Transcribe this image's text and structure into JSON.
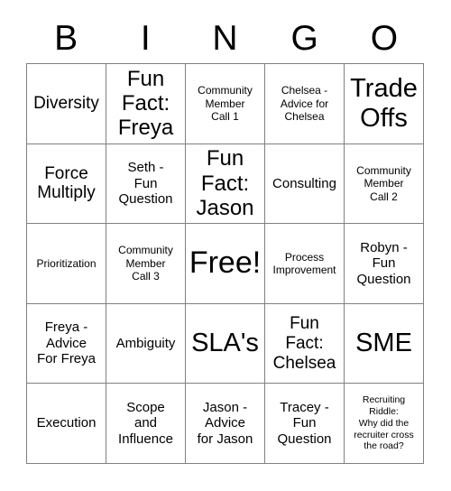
{
  "card": {
    "title": "BINGO",
    "header_letters": [
      "B",
      "I",
      "N",
      "G",
      "O"
    ],
    "columns": 5,
    "rows": 5,
    "free_space_index": 12,
    "colors": {
      "background": "#ffffff",
      "text": "#000000",
      "grid_line": "#808080"
    },
    "cells": [
      {
        "text": "Diversity",
        "size": "fs-lg"
      },
      {
        "text": "Fun\nFact:\nFreya",
        "size": "fs-xl"
      },
      {
        "text": "Community\nMember\nCall 1",
        "size": "fs-sm"
      },
      {
        "text": "Chelsea -\nAdvice for\nChelsea",
        "size": "fs-sm"
      },
      {
        "text": "Trade\nOffs",
        "size": "fs-xxl"
      },
      {
        "text": "Force\nMultiply",
        "size": "fs-lg"
      },
      {
        "text": "Seth -\nFun\nQuestion",
        "size": "fs-md"
      },
      {
        "text": "Fun\nFact:\nJason",
        "size": "fs-xl"
      },
      {
        "text": "Consulting",
        "size": "fs-md"
      },
      {
        "text": "Community\nMember\nCall 2",
        "size": "fs-sm"
      },
      {
        "text": "Prioritization",
        "size": "fs-sm"
      },
      {
        "text": "Community\nMember\nCall 3",
        "size": "fs-sm"
      },
      {
        "text": "Free!",
        "size": "fs-free"
      },
      {
        "text": "Process\nImprovement",
        "size": "fs-sm"
      },
      {
        "text": "Robyn -\nFun\nQuestion",
        "size": "fs-md"
      },
      {
        "text": "Freya -\nAdvice\nFor Freya",
        "size": "fs-md"
      },
      {
        "text": "Ambiguity",
        "size": "fs-md"
      },
      {
        "text": "SLA's",
        "size": "fs-xxl"
      },
      {
        "text": "Fun\nFact:\nChelsea",
        "size": "fs-lg"
      },
      {
        "text": "SME",
        "size": "fs-xxl"
      },
      {
        "text": "Execution",
        "size": "fs-md"
      },
      {
        "text": "Scope\nand\nInfluence",
        "size": "fs-md"
      },
      {
        "text": "Jason -\nAdvice\nfor Jason",
        "size": "fs-md"
      },
      {
        "text": "Tracey -\nFun\nQuestion",
        "size": "fs-md"
      },
      {
        "text": "Recruiting\nRiddle:\nWhy did the\nrecruiter cross\nthe road?",
        "size": "fs-xs"
      }
    ]
  }
}
